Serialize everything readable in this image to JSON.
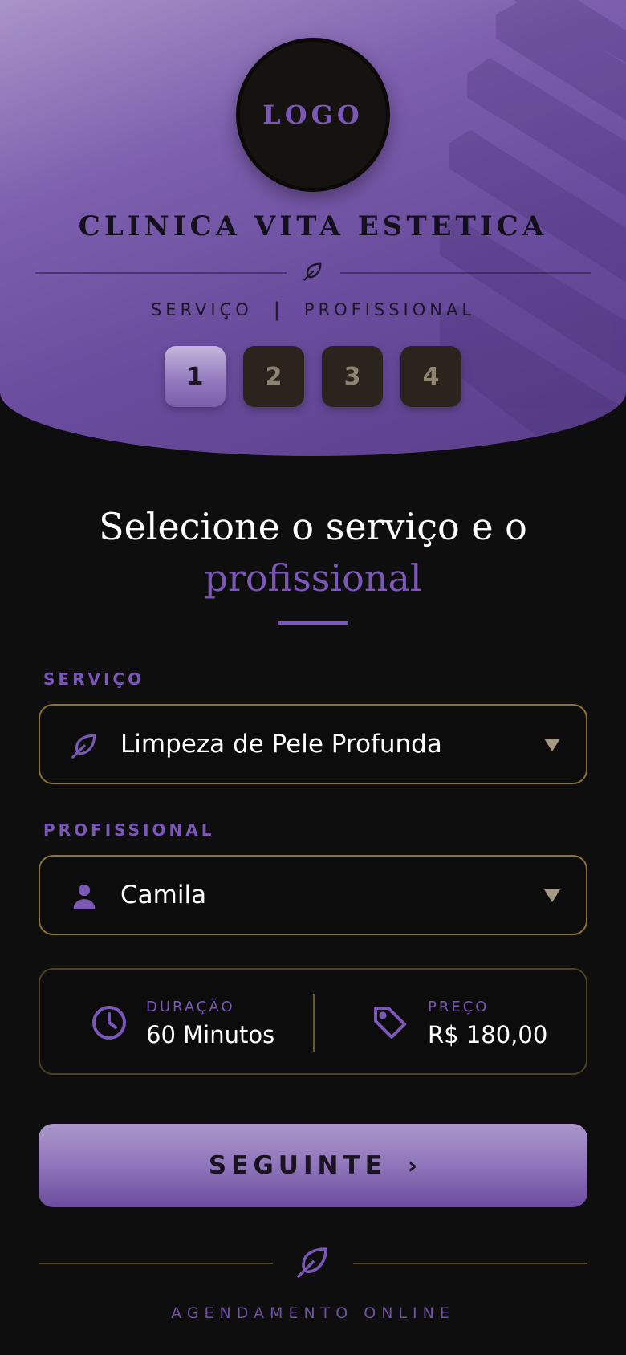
{
  "header": {
    "logo_text": "LOGO",
    "clinic_name": "CLINICA VITA ESTETICA",
    "breadcrumb": {
      "left": "SERVIÇO",
      "separator": "|",
      "right": "PROFISSIONAL"
    },
    "steps": [
      {
        "label": "1",
        "active": true
      },
      {
        "label": "2",
        "active": false
      },
      {
        "label": "3",
        "active": false
      },
      {
        "label": "4",
        "active": false
      }
    ]
  },
  "main": {
    "title_line1": "Selecione o serviço e o",
    "title_accent": "profissional",
    "service": {
      "label": "SERVIÇO",
      "value": "Limpeza de Pele Profunda",
      "icon": "leaf-icon"
    },
    "professional": {
      "label": "PROFISSIONAL",
      "value": "Camila",
      "icon": "person-icon"
    },
    "info": {
      "duration": {
        "label": "DURAÇÃO",
        "value": "60 Minutos",
        "icon": "clock-icon"
      },
      "price": {
        "label": "PREÇO",
        "value": "R$ 180,00",
        "icon": "price-tag-icon"
      }
    },
    "next_button": {
      "label": "SEGUINTE",
      "icon": "chevron-right-icon",
      "chevron": "›"
    }
  },
  "footer": {
    "text": "AGENDAMENTO ONLINE",
    "icon": "leaf-icon"
  },
  "colors": {
    "accent_purple": "#7b58b8",
    "gold_border": "#8a7430",
    "background": "#0e0e0e"
  }
}
